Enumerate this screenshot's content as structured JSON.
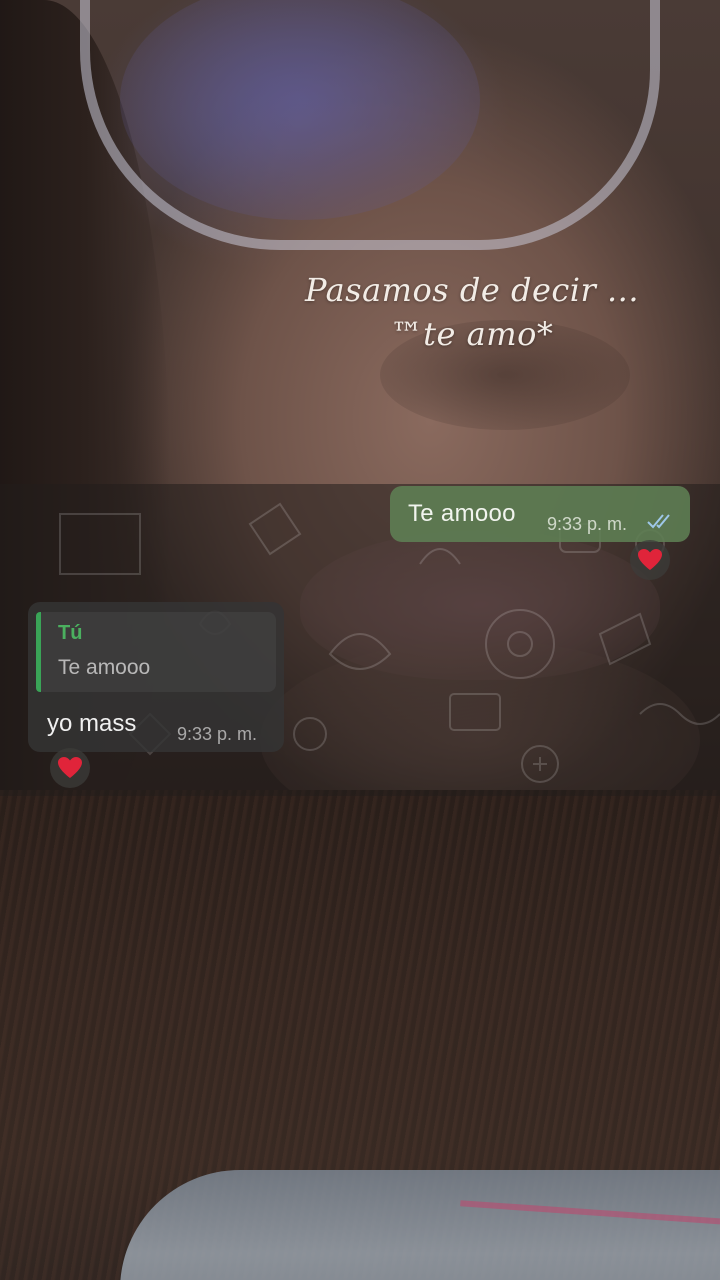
{
  "caption": {
    "line1": "Pasamos de decir ...",
    "line2": "™te amo*"
  },
  "chat": {
    "outgoing": {
      "text": "Te amooo",
      "time": "9:33 p. m.",
      "status": "read",
      "reaction": "❤️"
    },
    "incoming": {
      "reply_to_author": "Tú",
      "reply_to_text": "Te amooo",
      "text": "yo mass",
      "time": "9:33 p. m.",
      "reaction": "❤️"
    }
  },
  "colors": {
    "outgoing_bubble": "#5f8054",
    "incoming_bubble": "#343434",
    "quote_accent": "#3aa457",
    "read_ticks": "#9ec7e8"
  }
}
